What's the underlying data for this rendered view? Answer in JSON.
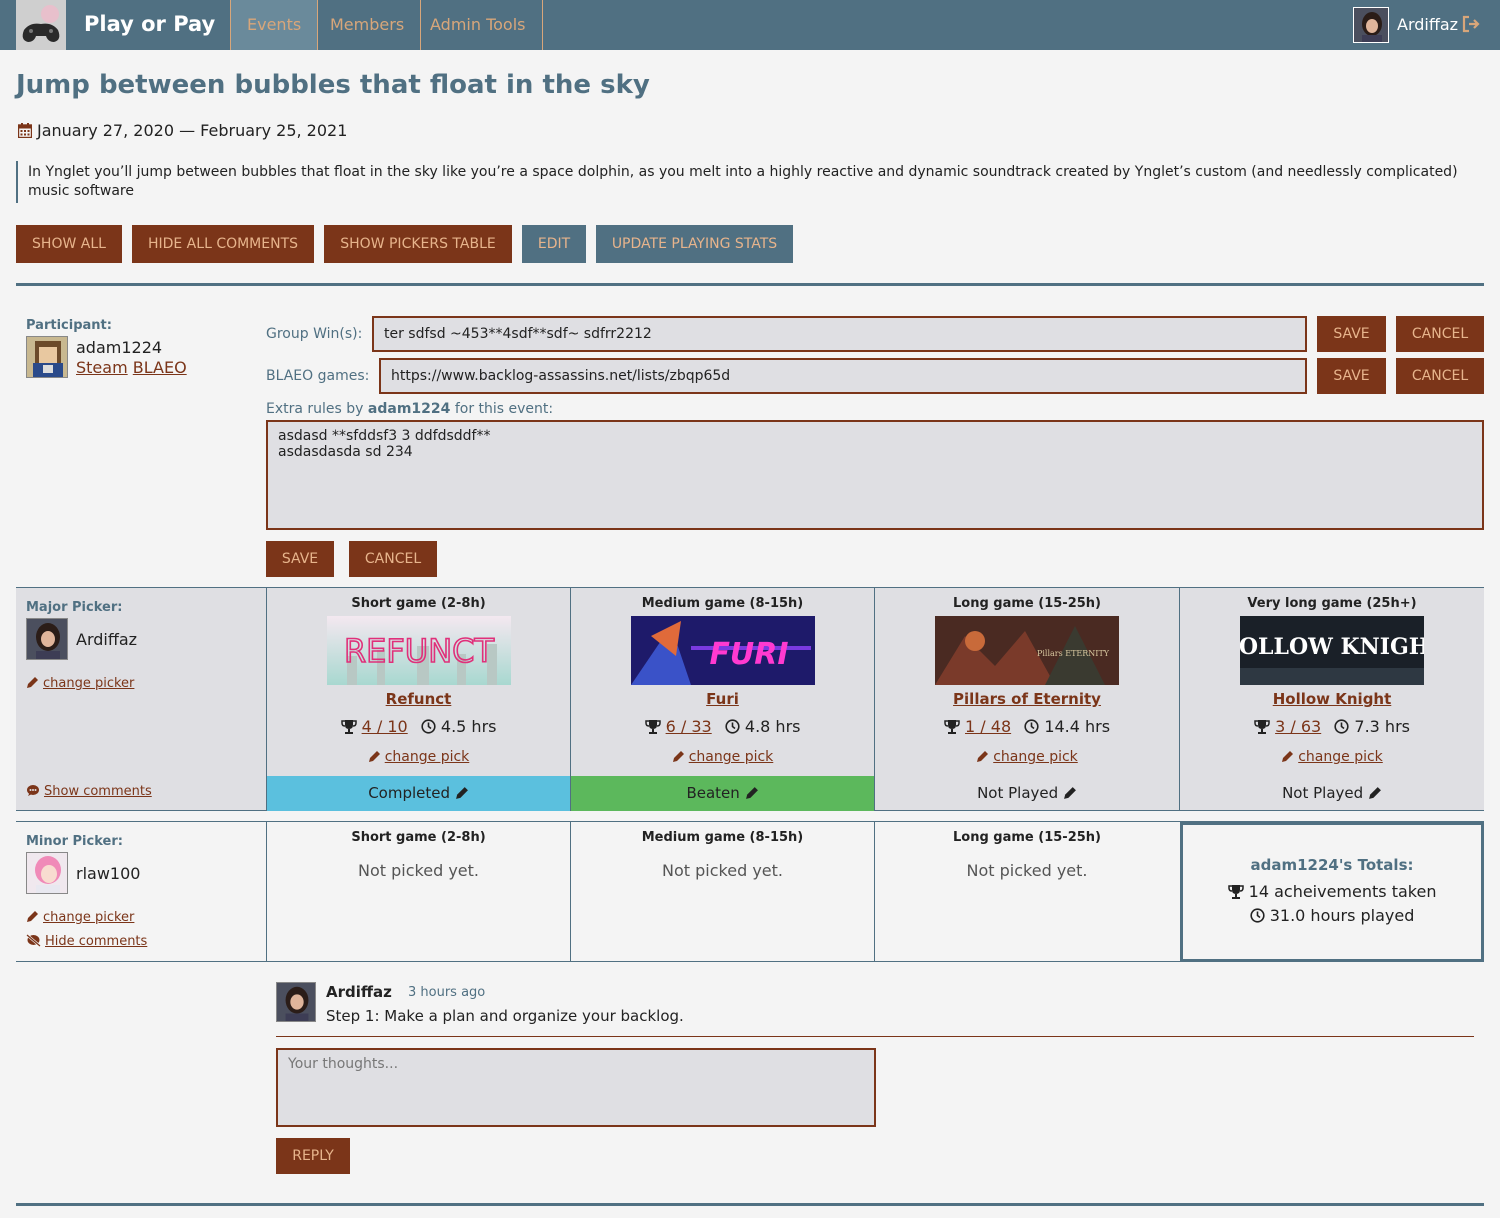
{
  "nav": {
    "brand": "Play or Pay",
    "tabs": [
      {
        "label": "Events"
      },
      {
        "label": "Members"
      },
      {
        "label": "Admin Tools"
      }
    ],
    "user": "Ardiffaz",
    "colors": {
      "bar": "#507082",
      "tab_text": "#d8a67a"
    }
  },
  "event": {
    "title": "Jump between bubbles that float in the sky",
    "dates": "January 27, 2020 — February 25, 2021",
    "description": "In Ynglet you’ll jump between bubbles that float in the sky like you’re a space dolphin, as you melt into a highly reactive and dynamic soundtrack created by Ynglet’s custom (and needlessly complicated) music software"
  },
  "actions": {
    "show_all": "Show all",
    "hide_comments": "Hide all comments",
    "show_pickers": "Show pickers table",
    "edit": "Edit",
    "update_stats": "Update playing stats"
  },
  "participant": {
    "label": "Participant:",
    "name": "adam1224",
    "steam": "Steam",
    "blaeo": "BLAEO",
    "group_wins_label": "Group Win(s):",
    "group_wins_value": "ter sdfsd ~453**4sdf**sdf~ sdfrr2212",
    "blaeo_label": "BLAEO games:",
    "blaeo_value": "https://www.backlog-assassins.net/lists/zbqp65d",
    "extra_rules_prefix": "Extra rules by ",
    "extra_rules_user": "adam1224",
    "extra_rules_suffix": " for this event:",
    "extra_rules_value": "asdasd **sfddsf3 3 ddfdsddf**\nasdasdasda sd 234",
    "save": "Save",
    "cancel": "Cancel"
  },
  "major": {
    "label": "Major Picker:",
    "name": "Ardiffaz",
    "change_picker": "change picker",
    "comments_toggle": "Show comments",
    "games": [
      {
        "category": "Short game (2-8h)",
        "title": "Refunct",
        "cover_text": "REFUNCT",
        "ach": "4 / 10",
        "hours": "4.5 hrs",
        "change": "change pick",
        "status": "Completed",
        "status_color": "#5bc0de"
      },
      {
        "category": "Medium game (8-15h)",
        "title": "Furi",
        "cover_text": "FURI",
        "ach": "6 / 33",
        "hours": "4.8 hrs",
        "change": "change pick",
        "status": "Beaten",
        "status_color": "#5cb85c"
      },
      {
        "category": "Long game (15-25h)",
        "title": "Pillars of Eternity",
        "cover_text": "Pillars ETERNITY",
        "ach": "1 / 48",
        "hours": "14.4 hrs",
        "change": "change pick",
        "status": "Not Played",
        "status_color": ""
      },
      {
        "category": "Very long game (25h+)",
        "title": "Hollow Knight",
        "cover_text": "HOLLOW KNIGHT",
        "ach": "3 / 63",
        "hours": "7.3 hrs",
        "change": "change pick",
        "status": "Not Played",
        "status_color": ""
      }
    ]
  },
  "minor": {
    "label": "Minor Picker:",
    "name": "rlaw100",
    "change_picker": "change picker",
    "comments_toggle": "Hide comments",
    "slots": [
      {
        "category": "Short game (2-8h)",
        "text": "Not picked yet."
      },
      {
        "category": "Medium game (8-15h)",
        "text": "Not picked yet."
      },
      {
        "category": "Long game (15-25h)",
        "text": "Not picked yet."
      }
    ]
  },
  "totals": {
    "title": "adam1224's Totals:",
    "achievements": "14 acheivements taken",
    "hours": "31.0 hours played"
  },
  "comment": {
    "author": "Ardiffaz",
    "time": "3 hours ago",
    "text": "Step 1: Make a plan and organize your backlog.",
    "reply_placeholder": "Your thoughts...",
    "reply": "Reply"
  }
}
